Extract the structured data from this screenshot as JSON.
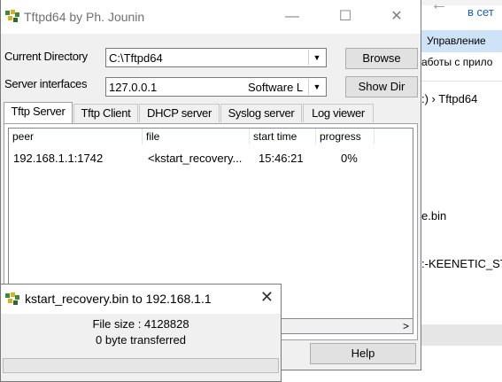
{
  "background": {
    "link_text": "в сет",
    "ribbon_text": "Управление",
    "line2_text": "аботы с прило",
    "breadcrumb": ":) › Tftpd64",
    "file1": "e.bin",
    "file2": ":-KEENETIC_ST"
  },
  "window": {
    "title": "Tftpd64 by Ph. Jounin",
    "minimize": "—",
    "maximize": "☐",
    "close": "✕"
  },
  "form": {
    "current_dir_label": "Current Directory",
    "current_dir_value": "C:\\Tftpd64",
    "server_if_label": "Server interfaces",
    "server_if_value": "127.0.0.1",
    "server_if_desc": "Software L",
    "browse_label": "Browse",
    "show_dir_label": "Show Dir"
  },
  "tabs": [
    "Tftp Server",
    "Tftp Client",
    "DHCP server",
    "Syslog server",
    "Log viewer"
  ],
  "table": {
    "columns": [
      "peer",
      "file",
      "start time",
      "progress"
    ],
    "rows": [
      {
        "peer": "192.168.1.1:1742",
        "file": "<kstart_recovery...",
        "start_time": "15:46:21",
        "progress": "0%"
      }
    ]
  },
  "help_label": "Help",
  "dialog": {
    "title": "kstart_recovery.bin to 192.168.1.1",
    "close": "✕",
    "file_size": "File size : 4128828",
    "transferred": "0 byte transferred",
    "progress_fraction": 0
  },
  "colors": {
    "link": "#1a5fb4",
    "ribbon": "#cfe3f8",
    "window_bg": "#f0f0f0"
  }
}
